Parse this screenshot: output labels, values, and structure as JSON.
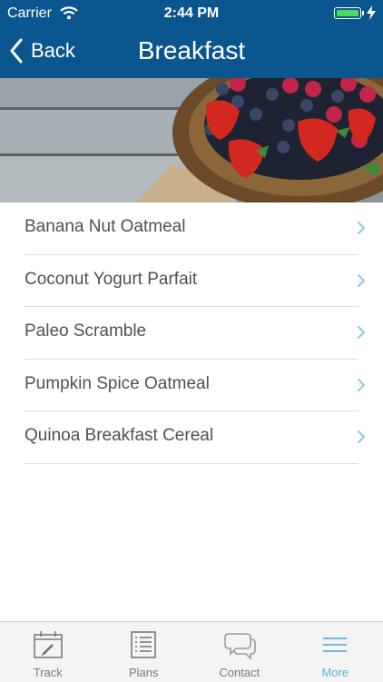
{
  "status_bar": {
    "carrier": "Carrier",
    "time": "2:44 PM",
    "battery_level": 1.0
  },
  "nav": {
    "back_label": "Back",
    "title": "Breakfast"
  },
  "recipes": [
    {
      "label": "Banana Nut Oatmeal"
    },
    {
      "label": "Coconut Yogurt Parfait"
    },
    {
      "label": "Paleo Scramble"
    },
    {
      "label": "Pumpkin Spice Oatmeal"
    },
    {
      "label": "Quinoa Breakfast Cereal"
    }
  ],
  "tabs": [
    {
      "label": "Track",
      "icon": "calendar-edit-icon"
    },
    {
      "label": "Plans",
      "icon": "document-list-icon"
    },
    {
      "label": "Contact",
      "icon": "chat-bubbles-icon"
    },
    {
      "label": "More",
      "icon": "menu-icon",
      "active": true
    }
  ],
  "colors": {
    "header": "#0b568f",
    "accent": "#5bb2d7",
    "text": "#505050",
    "battery": "#4cd964"
  }
}
